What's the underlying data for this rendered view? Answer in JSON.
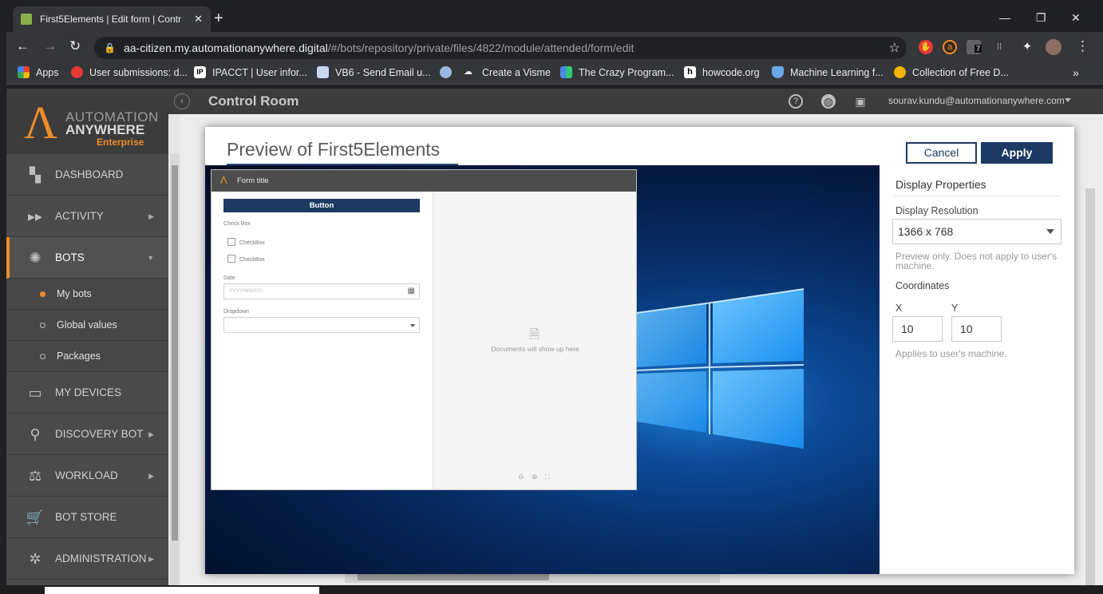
{
  "browser": {
    "tab_title": "First5Elements | Edit form | Contr",
    "url_host": "aa-citizen.my.automationanywhere.digital",
    "url_path": "/#/bots/repository/private/files/4822/module/attended/form/edit",
    "ext_badge": "7",
    "bookmarks": [
      {
        "label": "Apps",
        "icon": "apps-grid-icon",
        "color": "#e94235"
      },
      {
        "label": "User submissions: d...",
        "icon": "user-submissions-icon",
        "color": "#e53935"
      },
      {
        "label": "IPACCT | User infor...",
        "icon": "ipacct-icon",
        "color": "#ffffff"
      },
      {
        "label": "VB6 - Send Email u...",
        "icon": "document-icon",
        "color": "#c7d7f2"
      },
      {
        "label": "Create a Visme",
        "icon": "visme-icon",
        "color": "#9ab7df"
      },
      {
        "label": "The Crazy Program...",
        "icon": "crazy-programmer-icon",
        "color": "#4d8be0"
      },
      {
        "label": "howcode.org",
        "icon": "howcode-icon",
        "color": "#ffffff"
      },
      {
        "label": "Machine Learning f...",
        "icon": "shield-icon",
        "color": "#6aa7e8"
      },
      {
        "label": "Collection of Free D...",
        "icon": "collection-icon",
        "color": "#f5b400"
      }
    ]
  },
  "app": {
    "logo_line1": "AUTOMATION",
    "logo_line2": "ANYWHERE",
    "logo_line3": "Enterprise",
    "header_title": "Control Room",
    "user_email": "sourav.kundu@automationanywhere.com",
    "accent_color": "#f08c2a",
    "sidebar": [
      {
        "label": "DASHBOARD",
        "icon": "dashboard-icon",
        "arrow": false
      },
      {
        "label": "ACTIVITY",
        "icon": "activity-icon",
        "arrow": true
      },
      {
        "label": "BOTS",
        "icon": "bots-icon",
        "arrow": true,
        "active": true
      },
      {
        "label": "MY DEVICES",
        "icon": "devices-icon",
        "arrow": false
      },
      {
        "label": "DISCOVERY BOT",
        "icon": "discovery-icon",
        "arrow": true
      },
      {
        "label": "WORKLOAD",
        "icon": "workload-icon",
        "arrow": true
      },
      {
        "label": "BOT STORE",
        "icon": "cart-icon",
        "arrow": false
      },
      {
        "label": "ADMINISTRATION",
        "icon": "gear-icon",
        "arrow": true
      }
    ],
    "bots_submenu": [
      {
        "label": "My bots",
        "selected": true
      },
      {
        "label": "Global values",
        "selected": false
      },
      {
        "label": "Packages",
        "selected": false
      }
    ]
  },
  "modal": {
    "title": "Preview of First5Elements",
    "cancel_label": "Cancel",
    "apply_label": "Apply",
    "form": {
      "title": "Form title",
      "button_label": "Button",
      "checkbox_group_label": "Check Box",
      "checkbox_1": "CheckBox",
      "checkbox_2": "CheckBox",
      "date_label": "Date",
      "date_placeholder": "YYYY/MM/DD",
      "dropdown_label": "Dropdown",
      "documents_placeholder": "Documents will show up here"
    },
    "props": {
      "heading": "Display Properties",
      "resolution_label": "Display Resolution",
      "resolution_value": "1366 x 768",
      "preview_note": "Preview only. Does not apply to user's machine.",
      "coordinates_label": "Coordinates",
      "x_label": "X",
      "y_label": "Y",
      "x_value": "10",
      "y_value": "10",
      "applies_note": "Applies to user's machine."
    }
  }
}
